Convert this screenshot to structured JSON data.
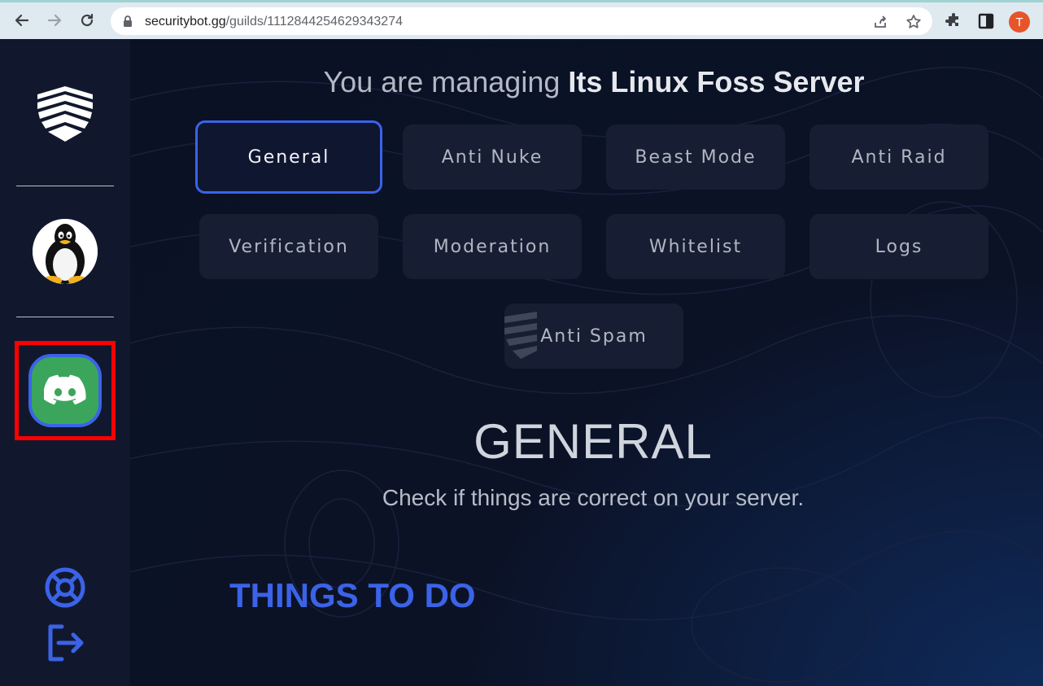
{
  "browser": {
    "url_host": "securitybot.gg",
    "url_path": "/guilds/1112844254629343274",
    "profile_initial": "T",
    "icons": [
      "back-arrow-icon",
      "forward-arrow-icon",
      "reload-icon",
      "lock-icon",
      "share-icon",
      "star-icon",
      "extensions-icon",
      "side-panel-icon"
    ]
  },
  "sidebar": {
    "logo": "shield-logo",
    "server_avatar": "linux-tux-avatar",
    "discord_button": "discord-icon",
    "bottom_icons": [
      "lifebuoy-icon",
      "logout-icon"
    ]
  },
  "header": {
    "prefix": "You are managing ",
    "server_name": "Its Linux Foss Server"
  },
  "tabs": [
    {
      "label": "General",
      "active": true
    },
    {
      "label": "Anti Nuke",
      "active": false
    },
    {
      "label": "Beast Mode",
      "active": false
    },
    {
      "label": "Anti Raid",
      "active": false
    },
    {
      "label": "Verification",
      "active": false
    },
    {
      "label": "Moderation",
      "active": false
    },
    {
      "label": "Whitelist",
      "active": false
    },
    {
      "label": "Logs",
      "active": false
    },
    {
      "label": "Anti Spam",
      "active": false
    }
  ],
  "section": {
    "title": "GENERAL",
    "subtitle": "Check if things are correct on your server.",
    "todo_title": "THINGS TO DO"
  },
  "colors": {
    "accent": "#3b63e8",
    "discord_green": "#3ba55c",
    "highlight_red": "#ff0000",
    "background": "#0b1226"
  }
}
